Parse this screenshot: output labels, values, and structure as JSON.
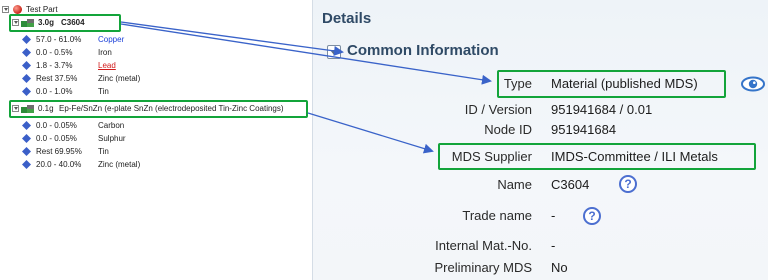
{
  "tree": {
    "root": {
      "label": "Test Part"
    },
    "materials": [
      {
        "weight": "3.0g",
        "name": "C3604",
        "substances": [
          {
            "range": "57.0 - 61.0%",
            "name": "Copper",
            "style": "blue"
          },
          {
            "range": "0.0 - 0.5%",
            "name": "Iron",
            "style": "normal"
          },
          {
            "range": "1.8 - 3.7%",
            "name": "Lead",
            "style": "red"
          },
          {
            "range": "Rest 37.5%",
            "name": "Zinc (metal)",
            "style": "normal"
          },
          {
            "range": "0.0 - 1.0%",
            "name": "Tin",
            "style": "normal"
          }
        ]
      },
      {
        "weight": "0.1g",
        "name": "Ep-Fe/SnZn (e-plate SnZn (electrodeposited Tin-Zinc Coatings)",
        "substances": [
          {
            "range": "0.0 - 0.05%",
            "name": "Carbon",
            "style": "normal"
          },
          {
            "range": "0.0 - 0.05%",
            "name": "Sulphur",
            "style": "normal"
          },
          {
            "range": "Rest 69.95%",
            "name": "Tin",
            "style": "normal"
          },
          {
            "range": "20.0 - 40.0%",
            "name": "Zinc (metal)",
            "style": "normal"
          }
        ]
      }
    ]
  },
  "details": {
    "title": "Details",
    "section_title": "Common Information",
    "fields": [
      {
        "label": "Type",
        "value": "Material (published MDS)"
      },
      {
        "label": "ID / Version",
        "value": "951941684 / 0.01"
      },
      {
        "label": "Node ID",
        "value": "951941684"
      },
      {
        "label": "MDS Supplier",
        "value": "IMDS-Committee / ILI Metals"
      },
      {
        "label": "Name",
        "value": "C3604"
      },
      {
        "label": "Trade name",
        "value": "-"
      },
      {
        "label": "Internal Mat.-No.",
        "value": "-"
      },
      {
        "label": "Preliminary MDS",
        "value": "No"
      }
    ],
    "help_symbol": "?"
  },
  "colors": {
    "highlight": "#13a43a",
    "arrow": "#3a63c9",
    "header_text": "#2f4a66",
    "help": "#4c6fd0"
  },
  "icons": {
    "expander": "triangle-down-icon",
    "part": "part-icon",
    "material": "material-icon",
    "substance": "substance-icon",
    "help": "help-icon",
    "view": "eye-icon"
  }
}
